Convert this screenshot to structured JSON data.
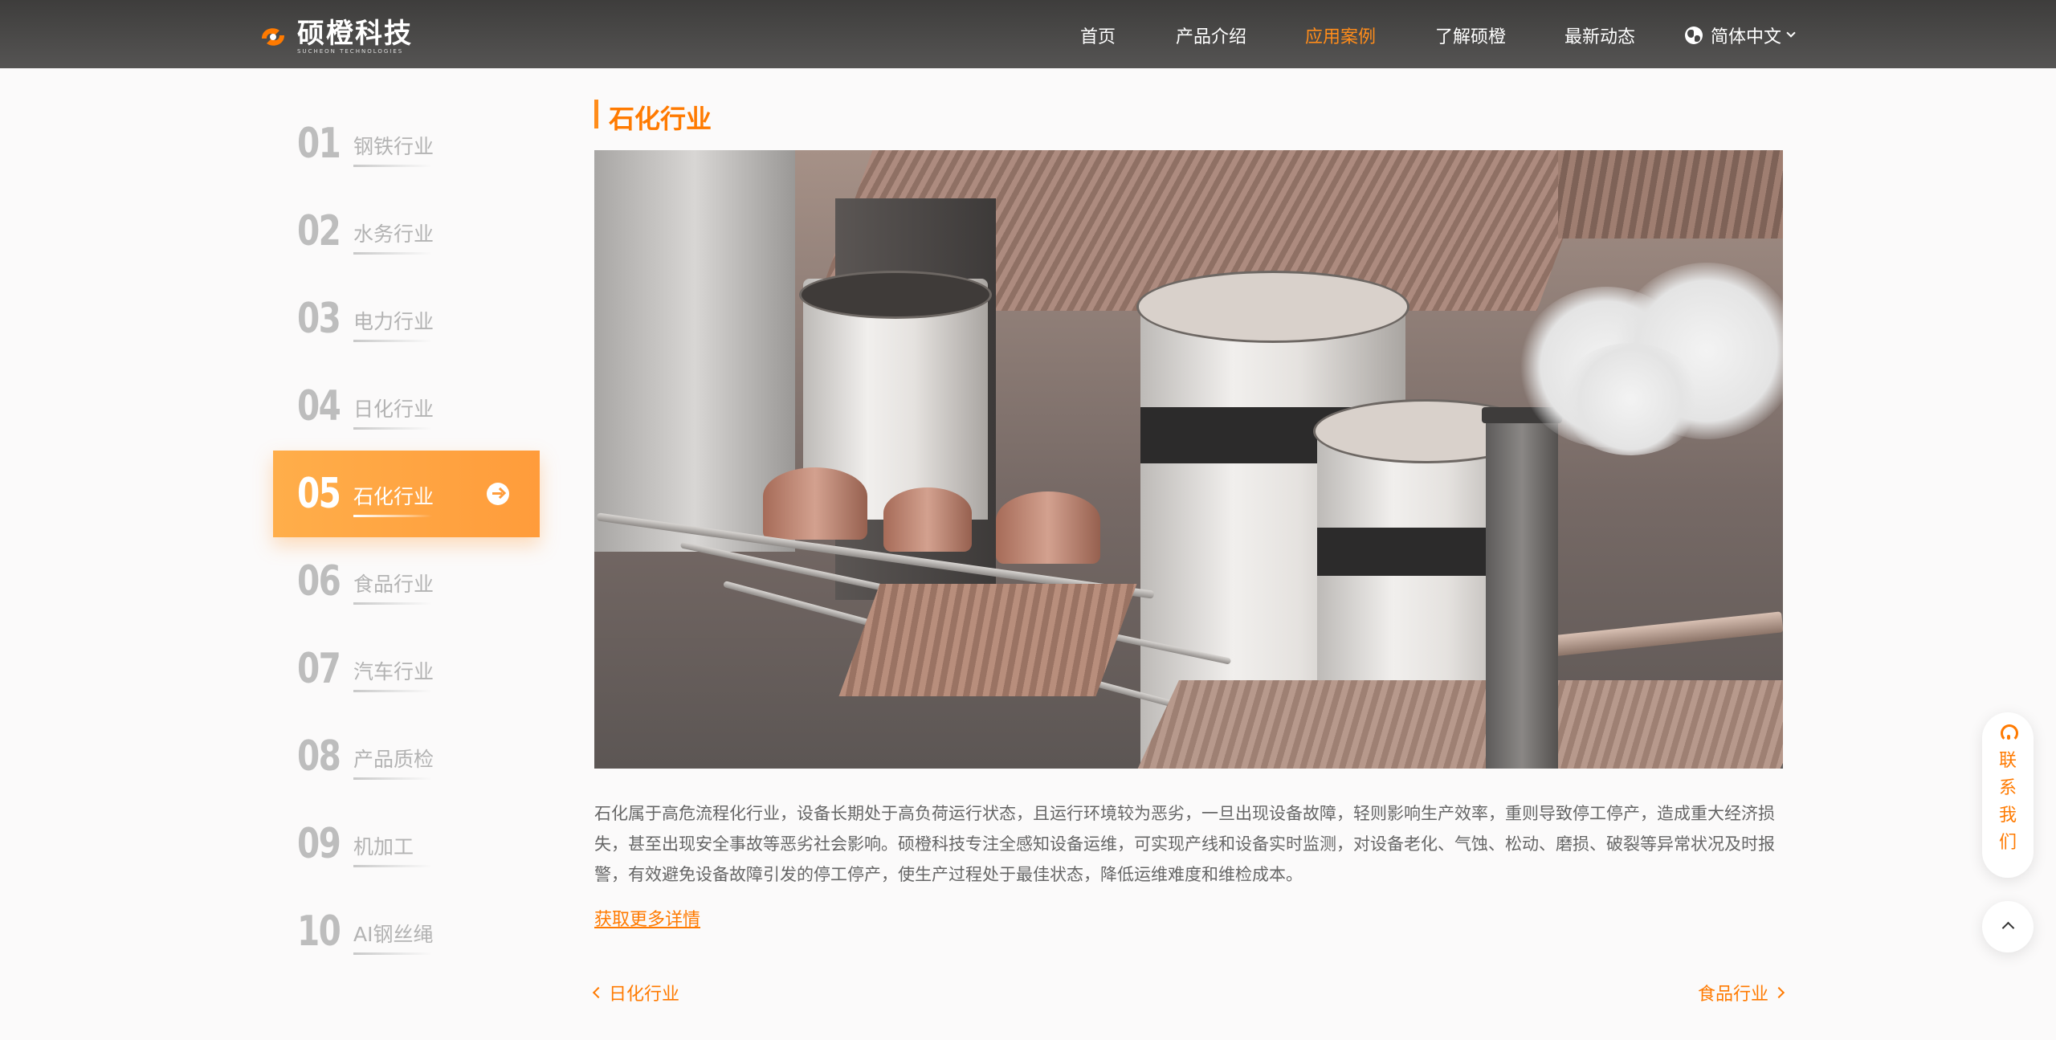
{
  "header": {
    "logo_cn": "硕橙科技",
    "logo_en": "SUCHEON TECHNOLOGIES",
    "nav": [
      {
        "label": "首页"
      },
      {
        "label": "产品介绍"
      },
      {
        "label": "应用案例"
      },
      {
        "label": "了解硕橙"
      },
      {
        "label": "最新动态"
      }
    ],
    "active_nav": "应用案例",
    "language": "简体中文"
  },
  "sidebar": {
    "items": [
      {
        "num": "01",
        "label": "钢铁行业"
      },
      {
        "num": "02",
        "label": "水务行业"
      },
      {
        "num": "03",
        "label": "电力行业"
      },
      {
        "num": "04",
        "label": "日化行业"
      },
      {
        "num": "05",
        "label": "石化行业"
      },
      {
        "num": "06",
        "label": "食品行业"
      },
      {
        "num": "07",
        "label": "汽车行业"
      },
      {
        "num": "08",
        "label": "产品质检"
      },
      {
        "num": "09",
        "label": "机加工"
      },
      {
        "num": "10",
        "label": "AI钢丝绳"
      }
    ],
    "active_index": 4
  },
  "main": {
    "title": "石化行业",
    "description": "石化属于高危流程化行业，设备长期处于高负荷运行状态，且运行环境较为恶劣，一旦出现设备故障，轻则影响生产效率，重则导致停工停产，造成重大经济损失，甚至出现安全事故等恶劣社会影响。硕橙科技专注全感知设备运维，可实现产线和设备实时监测，对设备老化、气蚀、松动、磨损、破裂等异常状况及时报警，有效避免设备故障引发的停工停产，使生产过程处于最佳状态，降低运维难度和维检成本。",
    "more_link": "获取更多详情",
    "prev_label": "日化行业",
    "next_label": "食品行业"
  },
  "contact": {
    "chars": [
      "联",
      "系",
      "我",
      "们"
    ]
  },
  "colors": {
    "accent": "#ff7a00",
    "active_item": "#ff9c3b",
    "header_bg": "#4a4948"
  }
}
